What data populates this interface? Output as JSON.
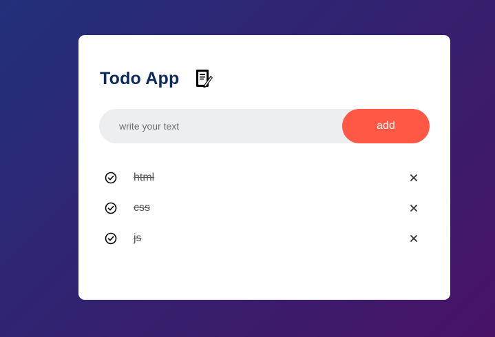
{
  "app": {
    "title": "Todo App",
    "icon": "notebook-pen-icon"
  },
  "input": {
    "placeholder": "write your text",
    "value": ""
  },
  "add_button": {
    "label": "add"
  },
  "todos": [
    {
      "text": "html",
      "completed": true
    },
    {
      "text": "css",
      "completed": true
    },
    {
      "text": "js",
      "completed": true
    }
  ],
  "colors": {
    "title": "#0c2a5e",
    "accent": "#ff5845",
    "input_bg": "#edeef0",
    "card_bg": "#ffffff"
  }
}
